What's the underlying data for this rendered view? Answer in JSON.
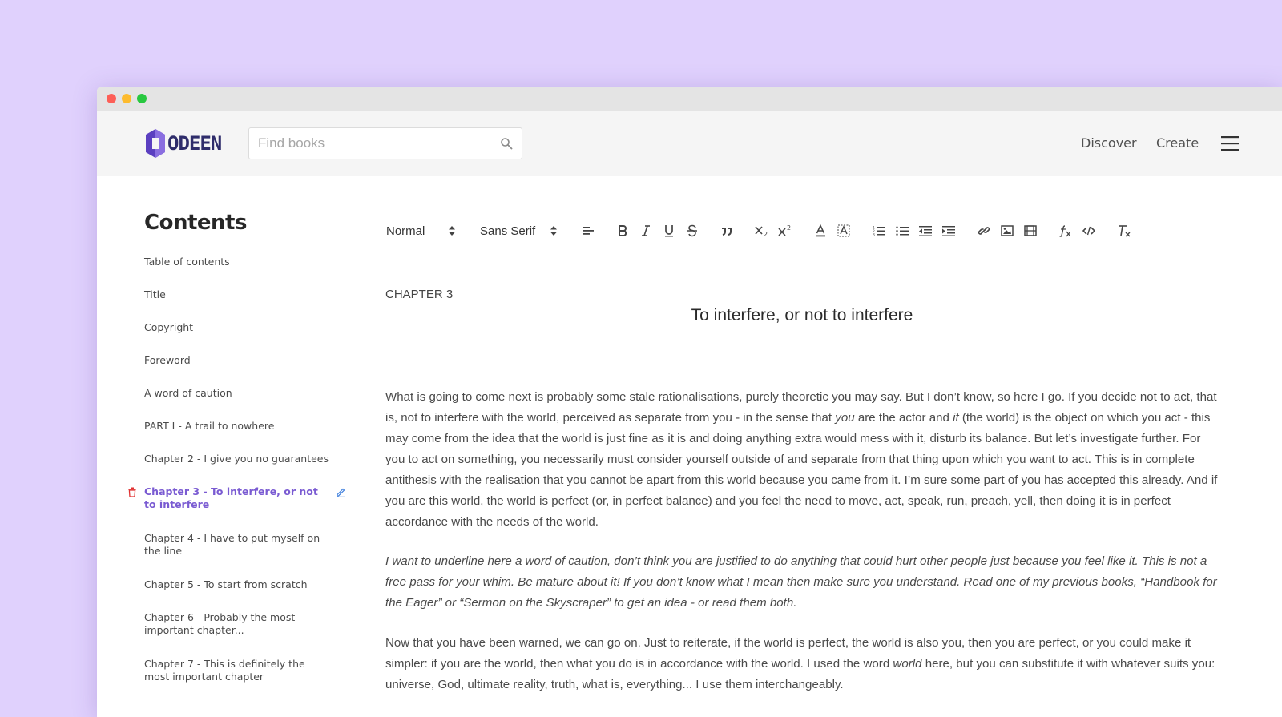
{
  "header": {
    "logo_text": "ODEEN",
    "search_placeholder": "Find books",
    "nav": {
      "discover": "Discover",
      "create": "Create"
    },
    "brand_color": "#6b4fd0"
  },
  "sidebar": {
    "title": "Contents",
    "items": [
      {
        "label": "Table of contents"
      },
      {
        "label": "Title"
      },
      {
        "label": "Copyright"
      },
      {
        "label": "Foreword"
      },
      {
        "label": "A word of caution"
      },
      {
        "label": "PART I - A trail to nowhere"
      },
      {
        "label": "Chapter 2 - I give you no guarantees"
      },
      {
        "label": "Chapter 3 - To interfere, or not to interfere",
        "active": true
      },
      {
        "label": "Chapter 4 - I have to put myself on the line"
      },
      {
        "label": "Chapter 5 - To start from scratch"
      },
      {
        "label": "Chapter 6 - Probably the most important chapter..."
      },
      {
        "label": "Chapter 7 - This is definitely the most important chapter"
      }
    ],
    "active_color": "#7a5bd2",
    "delete_color": "#e03131",
    "edit_color": "#3b7ddd"
  },
  "toolbar": {
    "heading_select": "Normal",
    "font_select": "Sans Serif",
    "buttons": [
      "align-left-icon",
      "bold-icon",
      "italic-icon",
      "underline-icon",
      "strike-icon",
      "blockquote-icon",
      "subscript-icon",
      "superscript-icon",
      "text-color-icon",
      "background-color-icon",
      "ordered-list-icon",
      "bullet-list-icon",
      "outdent-icon",
      "indent-icon",
      "link-icon",
      "image-icon",
      "video-icon",
      "formula-icon",
      "code-icon",
      "clear-format-icon"
    ]
  },
  "editor": {
    "chapter_label": "CHAPTER 3",
    "chapter_title": "To interfere, or not to interfere",
    "p1": {
      "a": "What is going to come next is probably some stale rationalisations, purely theoretic you may say. But I don’t know, so here I go. If you decide not to act, that is, not to interfere with the world, perceived as separate from you - in the sense that ",
      "em1": "you",
      "b": " are the actor and ",
      "em2": "it",
      "c": " (the world) is the object on which you act - this may come from the idea that the world is just fine as it is and doing anything extra would mess with it, disturb its balance. But let’s investigate further. For you to act on something, you necessarily must consider yourself outside of and separate from that thing upon which you want to act. This is in complete antithesis with the realisation that you cannot be apart from this world because you came from it. I’m sure some part of you has accepted this already. And if you are this world, the world is perfect (or, in perfect balance) and you feel the need to move, act, speak, run, preach, yell, then doing it is in perfect accordance with the needs of the world."
    },
    "p2": "I want to underline here a word of caution, don’t think you are justified to do anything that could hurt other people just because you feel like it. This is not a free pass for your whim. Be mature about it! If you don’t know what I mean then make sure you understand. Read one of my previous books, “Handbook for the Eager” or “Sermon on the Skyscraper” to get an idea - or read them both.",
    "p3": {
      "a": "Now that you have been warned, we can go on. Just to reiterate, if the world is perfect, the world is also you, then you are perfect, or you could make it simpler: if you are the world, then what you do is in accordance with the world. I used the word ",
      "em": "world",
      "b": " here, but you can substitute it with whatever suits you: universe, God, ultimate reality, truth, what is, everything... I use them interchangeably."
    }
  }
}
